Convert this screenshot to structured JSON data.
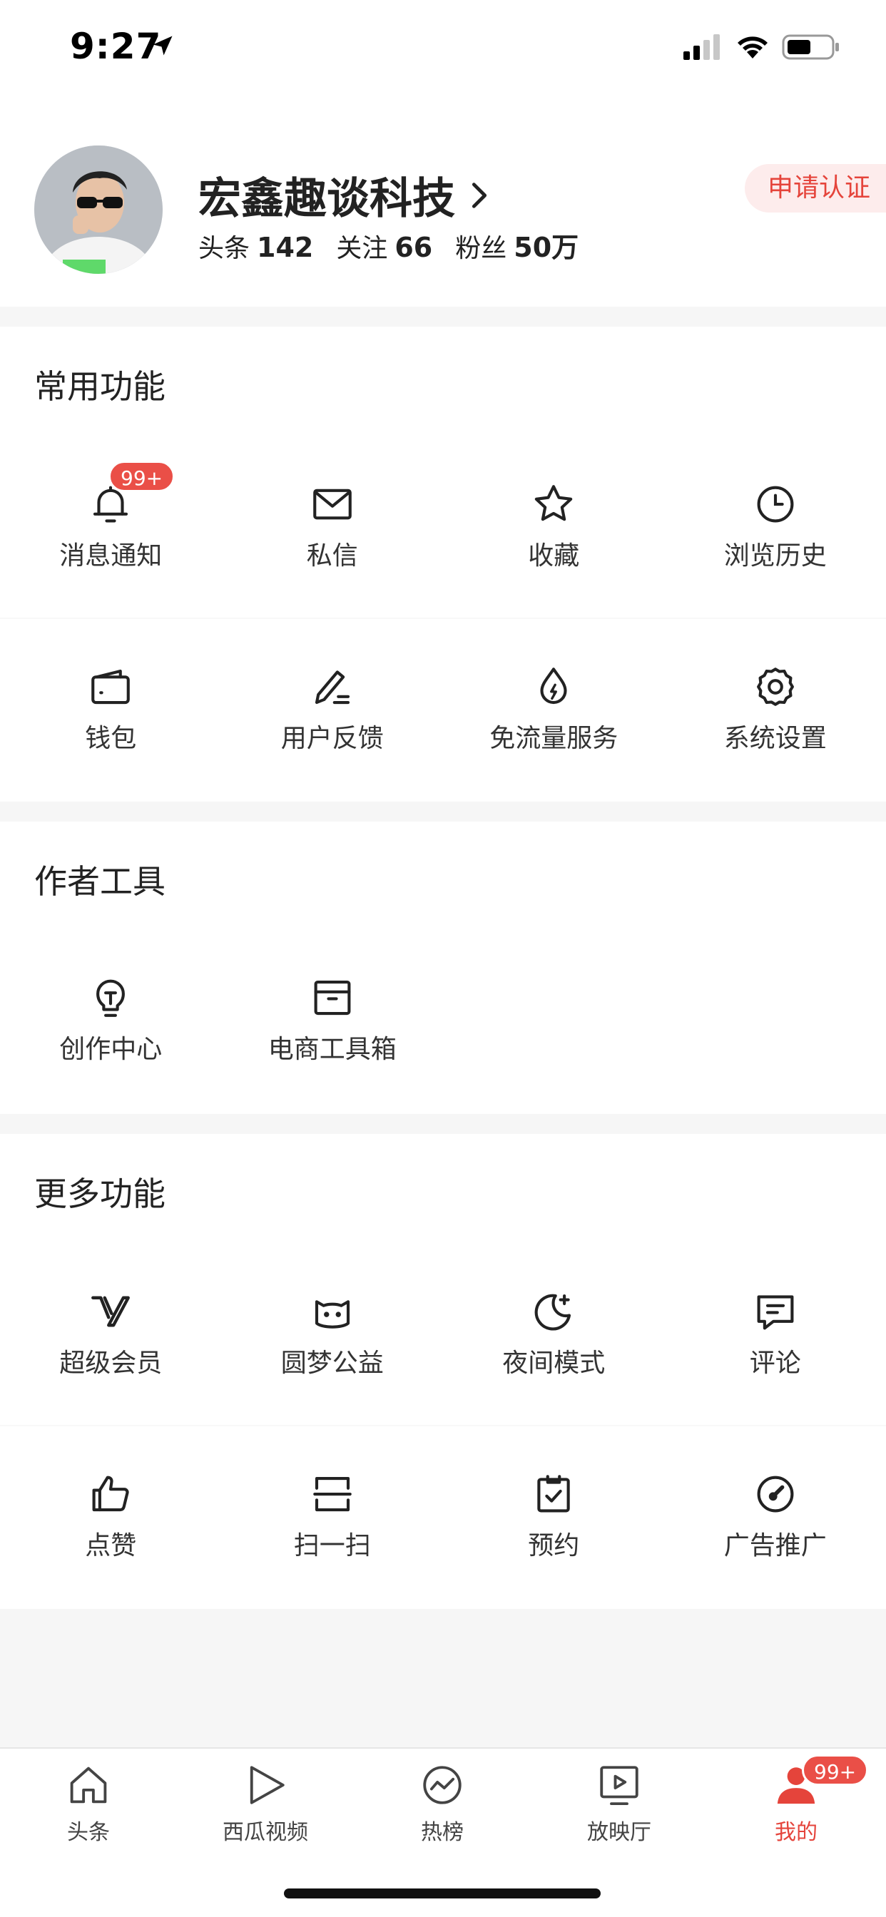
{
  "status_bar": {
    "time": "9:27"
  },
  "profile": {
    "username": "宏鑫趣谈科技",
    "stats": [
      {
        "label": "头条",
        "value": "142"
      },
      {
        "label": "关注",
        "value": "66"
      },
      {
        "label": "粉丝",
        "value": "50万"
      }
    ],
    "apply_cert_label": "申请认证"
  },
  "common": {
    "title": "常用功能",
    "items": [
      {
        "label": "消息通知",
        "icon": "bell-icon",
        "badge": "99+"
      },
      {
        "label": "私信",
        "icon": "mail-icon"
      },
      {
        "label": "收藏",
        "icon": "star-icon"
      },
      {
        "label": "浏览历史",
        "icon": "clock-icon"
      },
      {
        "label": "钱包",
        "icon": "wallet-icon"
      },
      {
        "label": "用户反馈",
        "icon": "pen-icon"
      },
      {
        "label": "免流量服务",
        "icon": "drop-icon"
      },
      {
        "label": "系统设置",
        "icon": "gear-icon"
      }
    ]
  },
  "author": {
    "title": "作者工具",
    "items": [
      {
        "label": "创作中心",
        "icon": "lightbulb-icon"
      },
      {
        "label": "电商工具箱",
        "icon": "box-icon"
      }
    ]
  },
  "more": {
    "title": "更多功能",
    "items": [
      {
        "label": "超级会员",
        "icon": "vip-icon"
      },
      {
        "label": "圆梦公益",
        "icon": "cat-face-icon"
      },
      {
        "label": "夜间模式",
        "icon": "moon-icon"
      },
      {
        "label": "评论",
        "icon": "comment-icon"
      },
      {
        "label": "点赞",
        "icon": "thumbs-up-icon"
      },
      {
        "label": "扫一扫",
        "icon": "scan-icon"
      },
      {
        "label": "预约",
        "icon": "clipboard-check-icon"
      },
      {
        "label": "广告推广",
        "icon": "gauge-icon"
      }
    ]
  },
  "bottom_nav": {
    "items": [
      {
        "label": "头条",
        "icon": "home-icon"
      },
      {
        "label": "西瓜视频",
        "icon": "play-icon"
      },
      {
        "label": "热榜",
        "icon": "trending-icon"
      },
      {
        "label": "放映厅",
        "icon": "tv-play-icon"
      },
      {
        "label": "我的",
        "icon": "user-icon",
        "active": true,
        "badge": "99+"
      }
    ]
  },
  "colors": {
    "accent": "#e5443b",
    "badge": "#ea4f47",
    "divider": "#f6f6f6"
  }
}
